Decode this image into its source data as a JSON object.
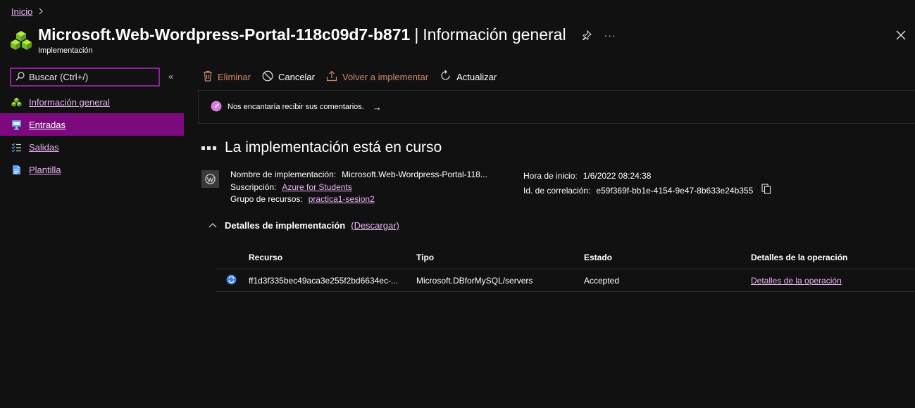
{
  "breadcrumb": {
    "home": "Inicio"
  },
  "header": {
    "title": "Microsoft.Web-Wordpress-Portal-118c09d7-b871",
    "separator": "|",
    "section": "Información general",
    "subtitle": "Implementación",
    "more": "···"
  },
  "search": {
    "placeholder": "Buscar (Ctrl+/)"
  },
  "sidebar": {
    "collapse": "«",
    "items": [
      {
        "label": "Información general",
        "icon": "deployment-icon",
        "active": false
      },
      {
        "label": "Entradas",
        "icon": "inputs-icon",
        "active": true
      },
      {
        "label": "Salidas",
        "icon": "outputs-icon",
        "active": false
      },
      {
        "label": "Plantilla",
        "icon": "template-icon",
        "active": false
      }
    ]
  },
  "toolbar": {
    "delete": "Eliminar",
    "cancel": "Cancelar",
    "redeploy": "Volver a implementar",
    "refresh": "Actualizar"
  },
  "banner": {
    "text": "Nos encantaría recibir sus comentarios.",
    "arrow": "→"
  },
  "status": {
    "title": "La implementación está en curso"
  },
  "deployment": {
    "name_label": "Nombre de implementación:",
    "name_value": "Microsoft.Web-Wordpress-Portal-118...",
    "subscription_label": "Suscripción:",
    "subscription_value": "Azure for Students",
    "resource_group_label": "Grupo de recursos:",
    "resource_group_value": "practica1-sesion2",
    "start_label": "Hora de inicio:",
    "start_value": "1/6/2022 08:24:38",
    "correlation_label": "Id. de correlación:",
    "correlation_value": "e59f369f-bb1e-4154-9e47-8b633e24b355"
  },
  "details": {
    "title": "Detalles de implementación",
    "download": "(Descargar)",
    "columns": [
      "Recurso",
      "Tipo",
      "Estado",
      "Detalles de la operación"
    ],
    "rows": [
      {
        "resource": "ff1d3f335bec49aca3e255f2bd6634ec-...",
        "type": "Microsoft.DBforMySQL/servers",
        "status": "Accepted",
        "op_details": "Detalles de la operación"
      }
    ]
  },
  "colors": {
    "accent": "#7c0a7e",
    "link": "#e9b3f1",
    "search_border": "#8f1f9f",
    "background": "#111112",
    "disabled_action": "#d08a6a"
  }
}
